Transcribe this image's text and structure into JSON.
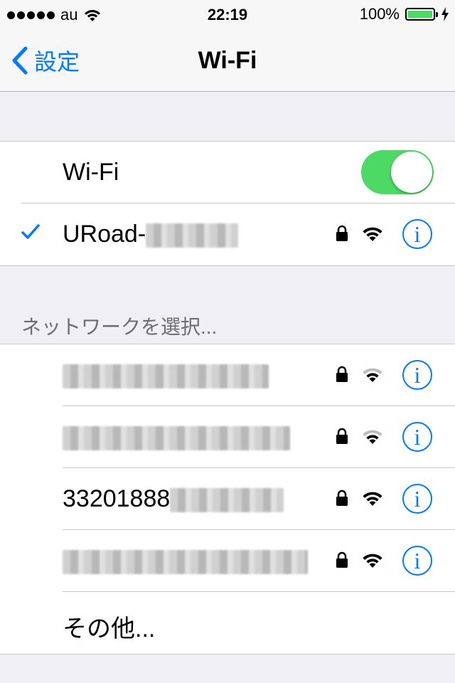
{
  "status_bar": {
    "carrier": "au",
    "time": "22:19",
    "battery": "100%"
  },
  "nav": {
    "back_label": "設定",
    "title": "Wi-Fi"
  },
  "wifi_toggle": {
    "label": "Wi-Fi",
    "on": true
  },
  "connected_network": {
    "name": "URoad-",
    "secured": true,
    "signal": "full"
  },
  "choose_network_header": "ネットワークを選択...",
  "networks": [
    {
      "name": "",
      "secured": true,
      "signal": "medium"
    },
    {
      "name": "",
      "secured": true,
      "signal": "medium"
    },
    {
      "name": "33201888",
      "secured": true,
      "signal": "full"
    },
    {
      "name": "",
      "secured": true,
      "signal": "full"
    }
  ],
  "other_label": "その他...",
  "colors": {
    "accent": "#007aff",
    "toggle_on": "#4cd964",
    "group_bg": "#efeff4"
  },
  "icons": {
    "back": "chevron-left-icon",
    "check": "checkmark-icon",
    "lock": "lock-icon",
    "wifi": "wifi-signal-icon",
    "info": "info-icon"
  },
  "info_glyph": "i"
}
